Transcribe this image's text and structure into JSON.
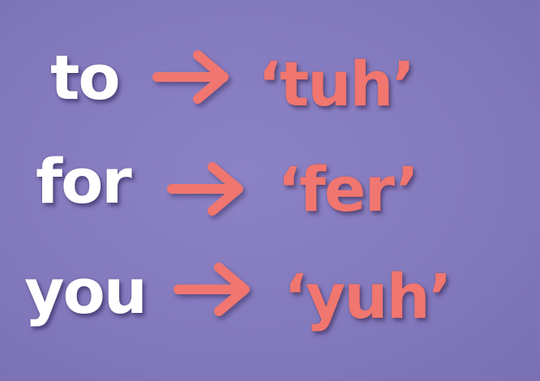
{
  "rows": [
    {
      "word": "to",
      "pronunciation": "‘tuh’"
    },
    {
      "word": "for",
      "pronunciation": "‘fer’"
    },
    {
      "word": "you",
      "pronunciation": "‘yuh’"
    }
  ],
  "icons": {
    "arrow": "right-arrow-icon"
  },
  "colors": {
    "background": "#8379bd",
    "word": "#ffffff",
    "pronunciation": "#f0766f",
    "arrow": "#f0766f"
  }
}
